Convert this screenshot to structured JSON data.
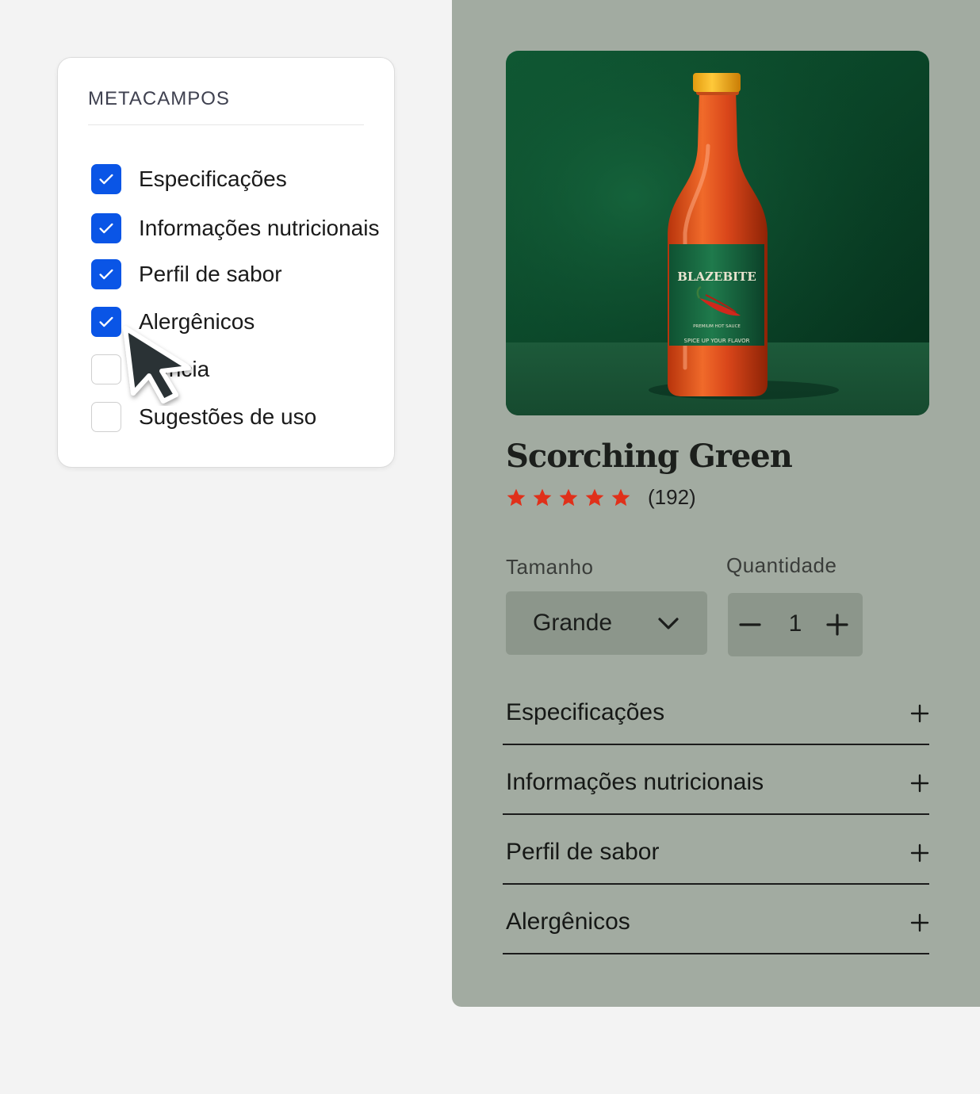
{
  "metafields": {
    "title": "METACAMPOS",
    "items": [
      {
        "label": "Especificações",
        "checked": true
      },
      {
        "label": "Informações nutricionais",
        "checked": true
      },
      {
        "label": "Perfil de sabor",
        "checked": true
      },
      {
        "label": "Alergênicos",
        "checked": true
      },
      {
        "label": "ıncia",
        "checked": false
      },
      {
        "label": "Sugestões de uso",
        "checked": false
      }
    ]
  },
  "product": {
    "image_label": {
      "brand": "BLAZEBITE",
      "line1": "PREMIUM HOT SAUCE",
      "line2": "SPICE UP YOUR FLAVOR"
    },
    "title": "Scorching Green",
    "rating": 5,
    "review_count": "(192)",
    "size_label": "Tamanho",
    "size_value": "Grande",
    "quantity_label": "Quantidade",
    "quantity_value": "1",
    "accordion": [
      {
        "label": "Especificações"
      },
      {
        "label": "Informações nutricionais"
      },
      {
        "label": "Perfil de sabor"
      },
      {
        "label": "Alergênicos"
      }
    ]
  },
  "colors": {
    "checkbox_checked": "#0a55e6",
    "panel_bg": "#a2aba1",
    "star": "#e0301a"
  }
}
